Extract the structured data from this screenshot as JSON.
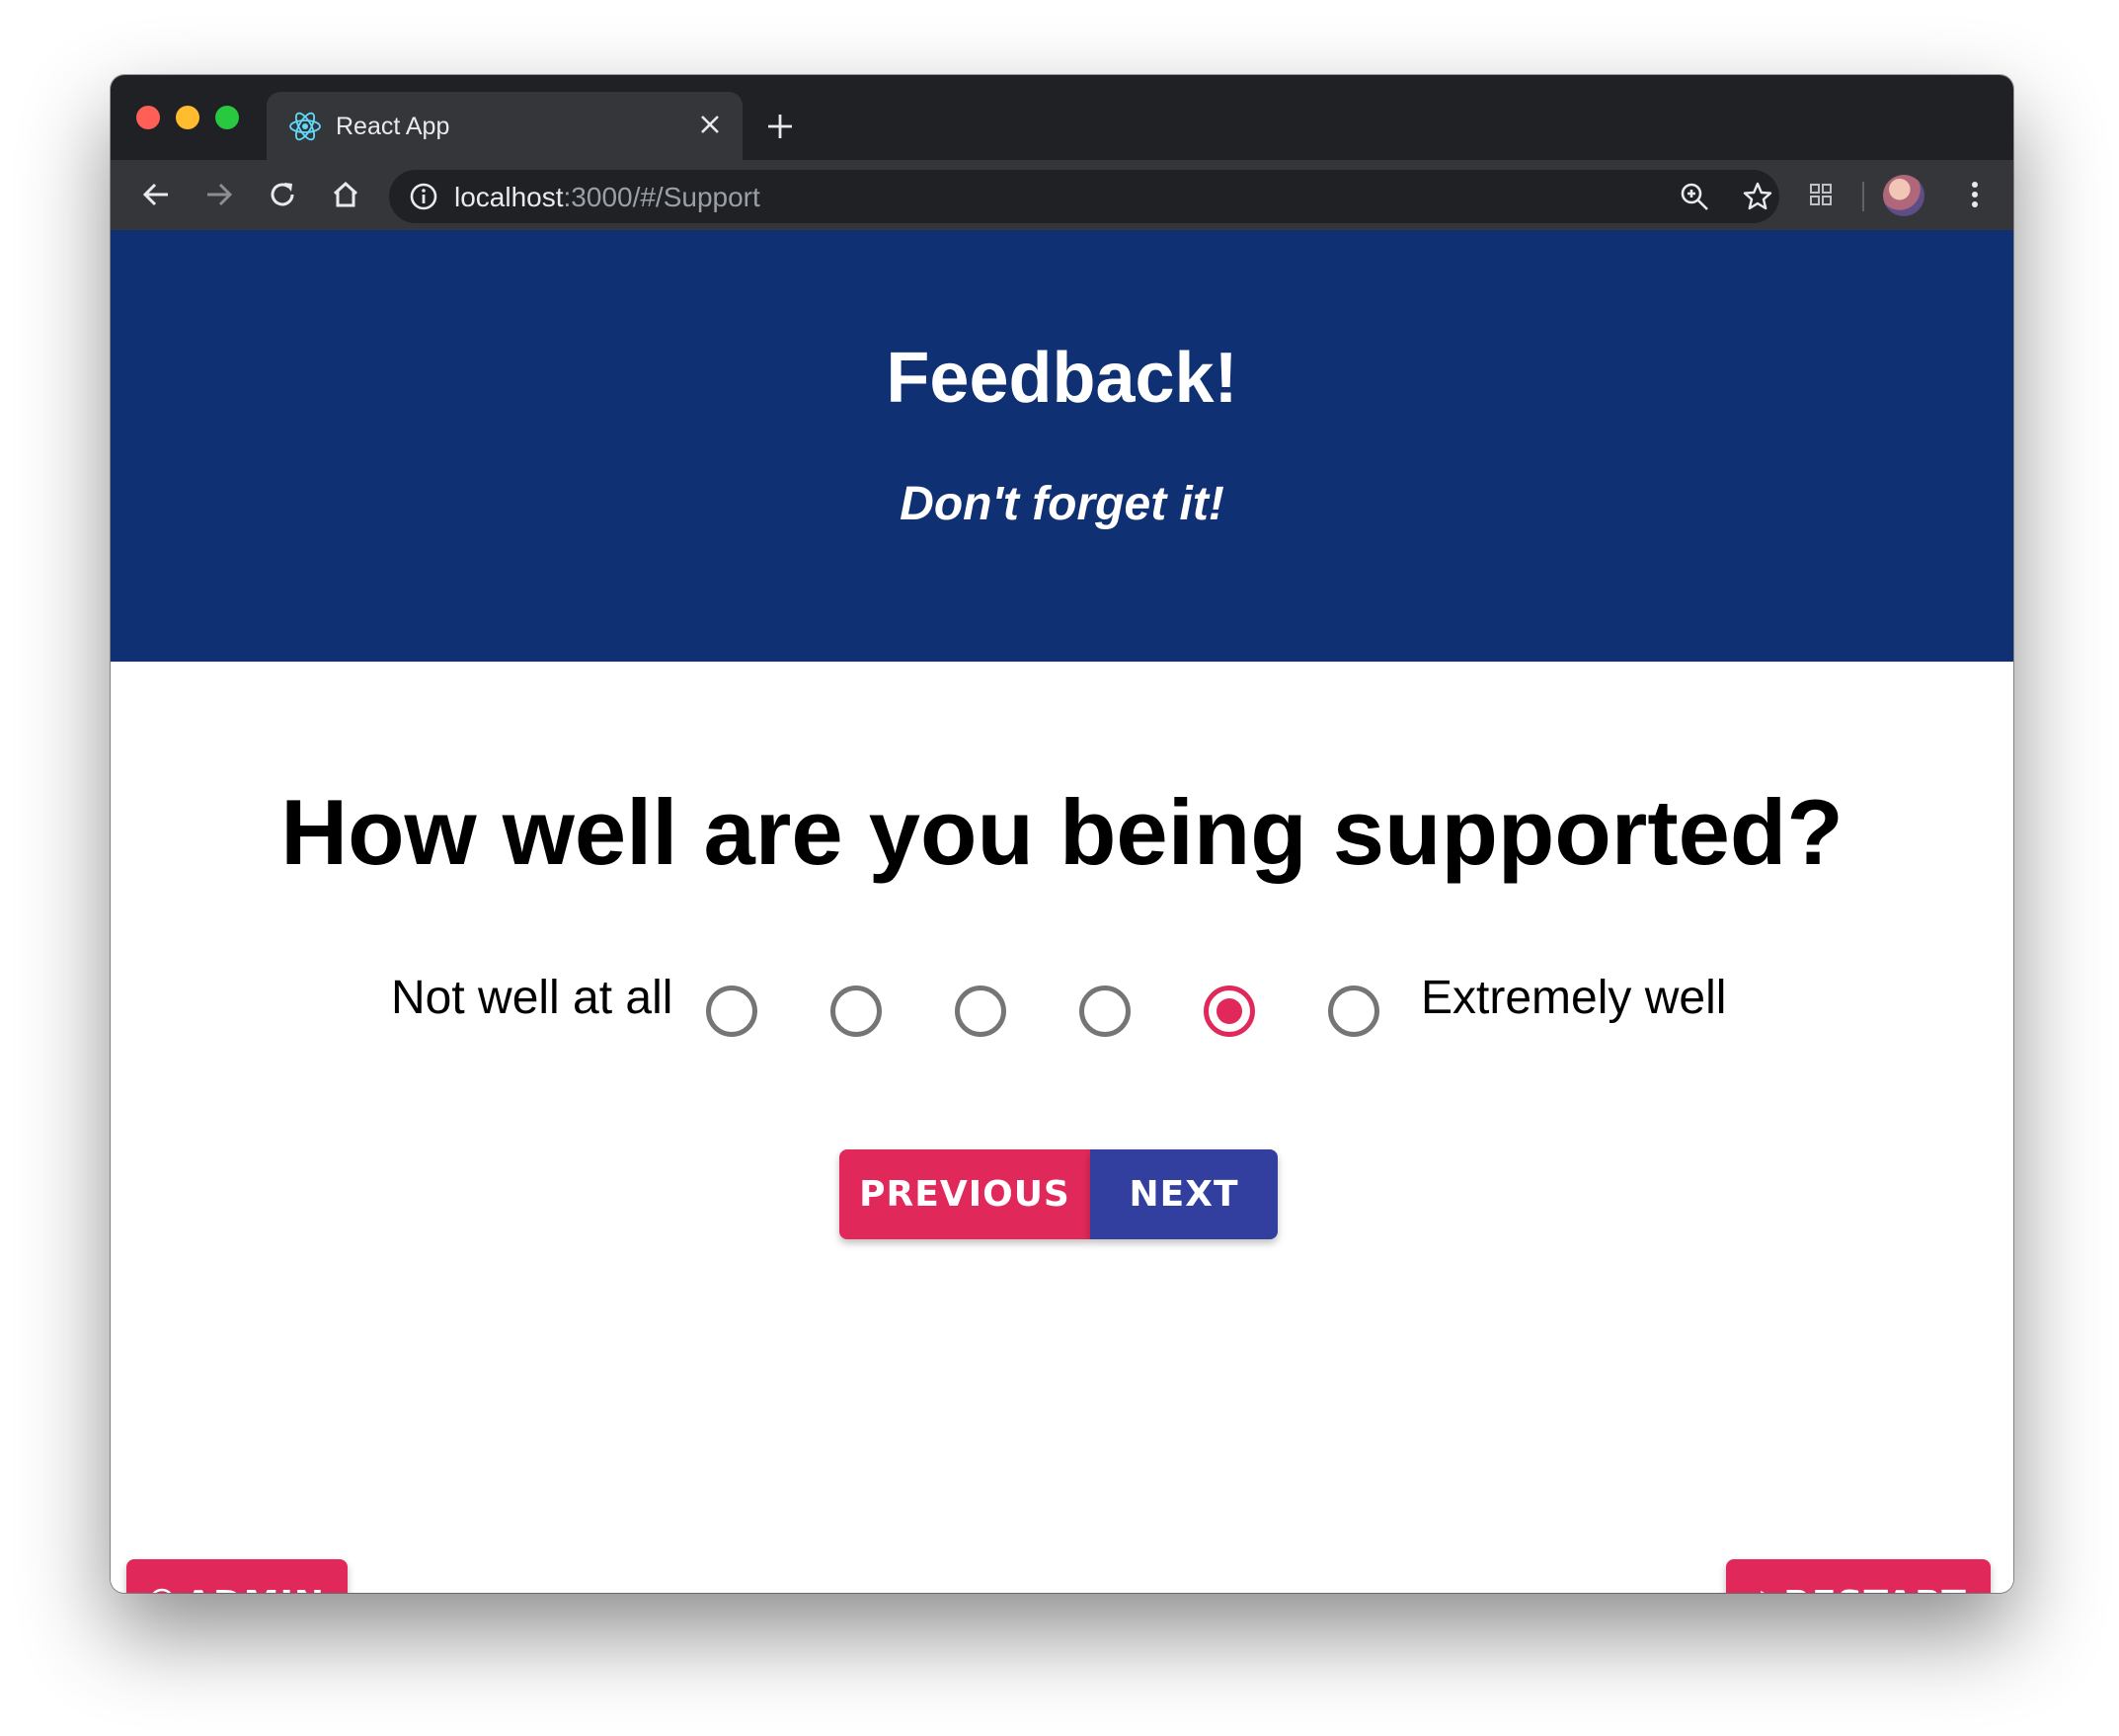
{
  "browser": {
    "tab_title": "React App",
    "url_host": "localhost",
    "url_rest": ":3000/#/Support"
  },
  "hero": {
    "title": "Feedback!",
    "subtitle": "Don't forget it!"
  },
  "question": {
    "text": "How well are you being supported?",
    "low_label": "Not well at all",
    "high_label": "Extremely well",
    "options": 6,
    "selected": 5
  },
  "nav": {
    "previous_label": "PREVIOUS",
    "next_label": "NEXT"
  },
  "footer": {
    "admin_label": "ADMIN",
    "admin_icon": "star-circle-icon",
    "restart_label": "RESTART",
    "restart_icon": "refresh-icon"
  },
  "colors": {
    "hero_bg": "#0f3073",
    "accent_pink": "#e0295a",
    "accent_indigo": "#333f9e"
  }
}
